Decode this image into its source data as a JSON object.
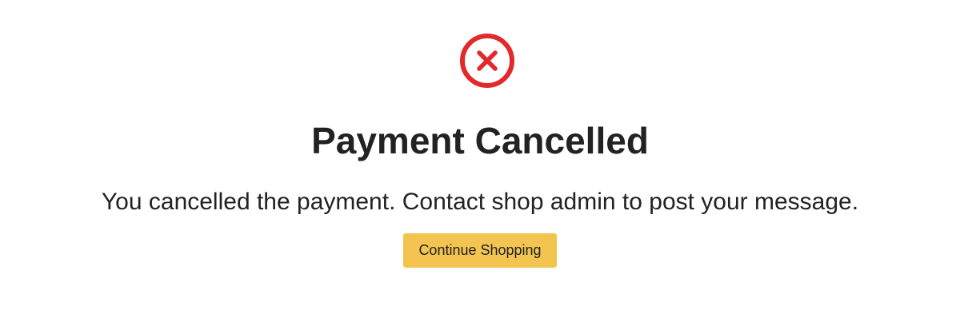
{
  "status": {
    "icon": "cancel-circle-icon",
    "icon_color": "#e3292b"
  },
  "title": "Payment Cancelled",
  "message": "You cancelled the payment. Contact shop admin to post your message.",
  "action": {
    "label": "Continue Shopping",
    "background_color": "#f3c44f"
  }
}
